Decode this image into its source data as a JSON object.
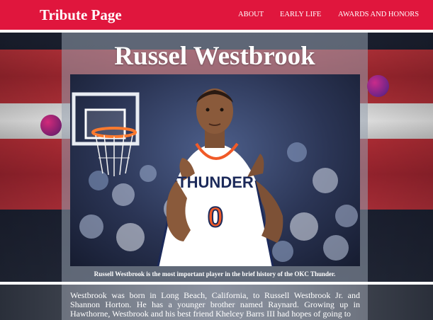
{
  "navbar": {
    "brand": "Tribute Page",
    "links": [
      "ABOUT",
      "EARLY LIFE",
      "AWARDS AND HONORS"
    ],
    "background": "#e0163d"
  },
  "hero": {
    "title": "Russel Westbrook",
    "caption": "Russell Westbrook is the most important player in the brief history of the OKC Thunder.",
    "jersey_team": "THUNDER",
    "jersey_number": "0"
  },
  "bio": {
    "text": "Westbrook was born in Long Beach, California, to Russell Westbrook Jr. and Shannon Horton. He has a younger brother named Raynard. Growing up in Hawthorne, Westbrook and his best friend Khelcey Barrs III had hopes of going to"
  }
}
